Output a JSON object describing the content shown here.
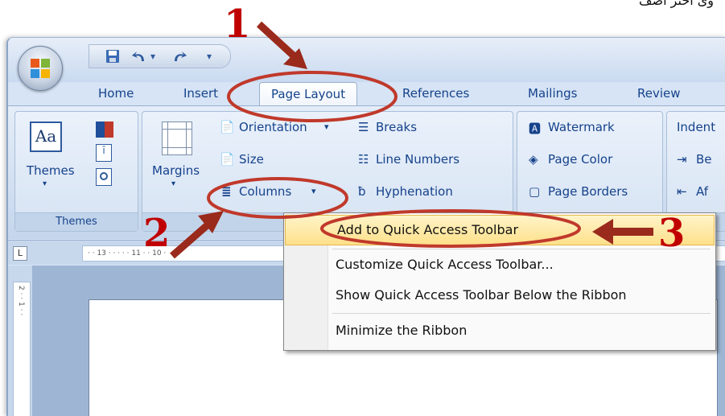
{
  "caption": "وی اختر أضف",
  "quick_access": {
    "save_icon": "save-icon",
    "undo_icon": "undo-icon",
    "redo_icon": "redo-icon",
    "customize_icon": "customize-arrow-icon"
  },
  "tabs": [
    "Home",
    "Insert",
    "Page Layout",
    "References",
    "Mailings",
    "Review"
  ],
  "active_tab": "Page Layout",
  "ribbon": {
    "themes": {
      "label": "Themes",
      "group_label": "Themes"
    },
    "margins_label": "Margins",
    "orientation_label": "Orientation",
    "size_label": "Size",
    "columns_label": "Columns",
    "breaks_label": "Breaks",
    "line_numbers_label": "Line Numbers",
    "hyphenation_label": "Hyphenation",
    "page_setup_group_label": "Pa",
    "watermark_label": "Watermark",
    "page_color_label": "Page Color",
    "page_borders_label": "Page Borders",
    "indent_label": "Indent",
    "before_label": "Be",
    "after_label": "Af"
  },
  "ruler_marks": "·  ·  13 ·  ·  ·  ·  ·  11  ·  ·  10  ·",
  "vruler_marks": "2 · · 1 · ·",
  "context_menu": {
    "items": [
      {
        "label": "Add to Quick Access Toolbar",
        "highlighted": true
      },
      {
        "label": "Customize Quick Access Toolbar...",
        "highlighted": false
      },
      {
        "label": "Show Quick Access Toolbar Below the Ribbon",
        "highlighted": false
      },
      {
        "label": "Minimize the Ribbon",
        "highlighted": false
      }
    ]
  },
  "annotations": {
    "step1": "1",
    "step2": "2",
    "step3": "3"
  },
  "colors": {
    "annotation_red": "#c00000",
    "ribbon_text": "#15428b",
    "highlight": "#fee08a"
  }
}
